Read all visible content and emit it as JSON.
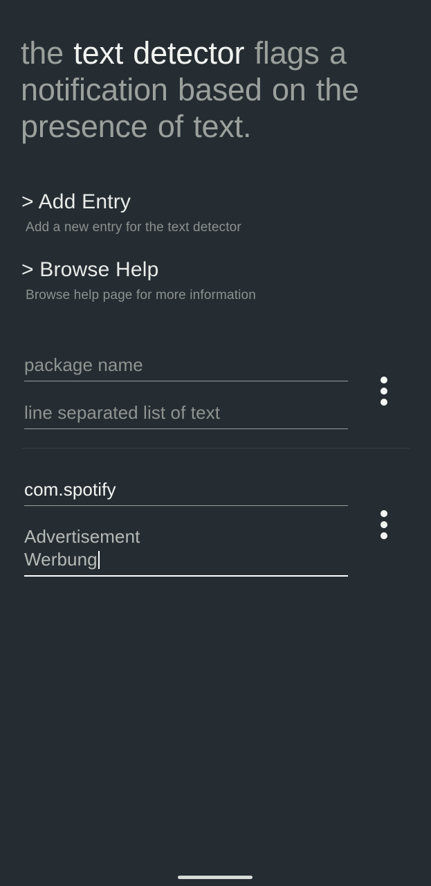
{
  "app": {
    "background_color": "#262d32",
    "accent_color": "#f2f4f2"
  },
  "heading": {
    "part_1": "the ",
    "part_2": "text detector",
    "part_3": " flags a notification based on the presence of text."
  },
  "menu": {
    "items": [
      {
        "title": "> Add Entry",
        "subtitle": "Add a new entry for the text detector"
      },
      {
        "title": "> Browse Help",
        "subtitle": "Browse help page for more information"
      }
    ]
  },
  "entries": [
    {
      "package_field": {
        "placeholder": "package name",
        "value": "",
        "focused": false
      },
      "text_field": {
        "placeholder": "line separated list of text",
        "value": "",
        "focused": false
      },
      "overflow_label": "⋮"
    },
    {
      "package_field": {
        "placeholder": "package name",
        "value": "com.spotify",
        "focused": false
      },
      "text_field": {
        "placeholder": "line separated list of text",
        "value": "Advertisement\nWerbung",
        "focused": true
      },
      "overflow_label": "⋮"
    }
  ],
  "nav": {
    "gesture_bar": "home-gesture-bar"
  }
}
